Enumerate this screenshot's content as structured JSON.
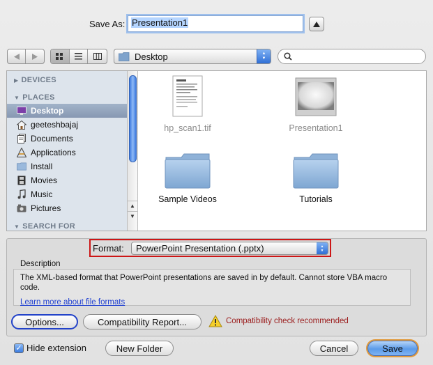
{
  "save_as": {
    "label": "Save As:",
    "filename": "Presentation1"
  },
  "toolbar": {
    "location": "Desktop",
    "search_placeholder": ""
  },
  "sidebar": {
    "devices_header": "DEVICES",
    "places_header": "PLACES",
    "search_header": "SEARCH FOR",
    "items": [
      {
        "label": "Desktop",
        "icon": "desktop-icon",
        "selected": true
      },
      {
        "label": "geeteshbajaj",
        "icon": "home-icon",
        "selected": false
      },
      {
        "label": "Documents",
        "icon": "documents-icon",
        "selected": false
      },
      {
        "label": "Applications",
        "icon": "applications-icon",
        "selected": false
      },
      {
        "label": "Install",
        "icon": "folder-icon",
        "selected": false
      },
      {
        "label": "Movies",
        "icon": "movies-icon",
        "selected": false
      },
      {
        "label": "Music",
        "icon": "music-icon",
        "selected": false
      },
      {
        "label": "Pictures",
        "icon": "pictures-icon",
        "selected": false
      }
    ]
  },
  "files": [
    {
      "name": "hp_scan1.tif",
      "kind": "document",
      "dimmed": true
    },
    {
      "name": "Presentation1",
      "kind": "presentation",
      "dimmed": true
    },
    {
      "name": "Sample Videos",
      "kind": "folder",
      "dimmed": false
    },
    {
      "name": "Tutorials",
      "kind": "folder",
      "dimmed": false
    }
  ],
  "options": {
    "format_label": "Format:",
    "format_value": "PowerPoint Presentation (.pptx)",
    "description_title": "Description",
    "description_text": "The XML-based format that PowerPoint presentations are saved in by default. Cannot store VBA macro code.",
    "learn_more_link": "Learn more about file formats",
    "options_button": "Options...",
    "compat_button": "Compatibility Report...",
    "compat_warning": "Compatibility check recommended"
  },
  "footer": {
    "hide_extension_label": "Hide extension",
    "hide_extension_checked": true,
    "new_folder_button": "New Folder",
    "cancel_button": "Cancel",
    "save_button": "Save"
  },
  "colors": {
    "highlight_red": "#cc1616",
    "focus_blue": "#2242c8",
    "default_button_ring": "#e19a3c",
    "warning_text": "#9b1c1c"
  }
}
